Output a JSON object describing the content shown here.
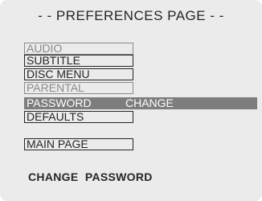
{
  "header": {
    "title": "- - PREFERENCES PAGE - -"
  },
  "menu": {
    "items": [
      {
        "label": "AUDIO",
        "state": "dim"
      },
      {
        "label": "SUBTITLE",
        "state": "normal"
      },
      {
        "label": "DISC MENU",
        "state": "normal"
      },
      {
        "label": "PARENTAL",
        "state": "dim"
      },
      {
        "label": "PASSWORD",
        "state": "selected"
      },
      {
        "label": "DEFAULTS",
        "state": "normal"
      }
    ],
    "main_page": "MAIN PAGE"
  },
  "submenu": {
    "option": "CHANGE"
  },
  "status": {
    "text": "CHANGE  PASSWORD"
  },
  "colors": {
    "background": "#ebebeb",
    "text": "#262626",
    "disabled": "#8a8a8a",
    "highlight": "#7d7d7d",
    "highlight_text": "#ffffff"
  }
}
